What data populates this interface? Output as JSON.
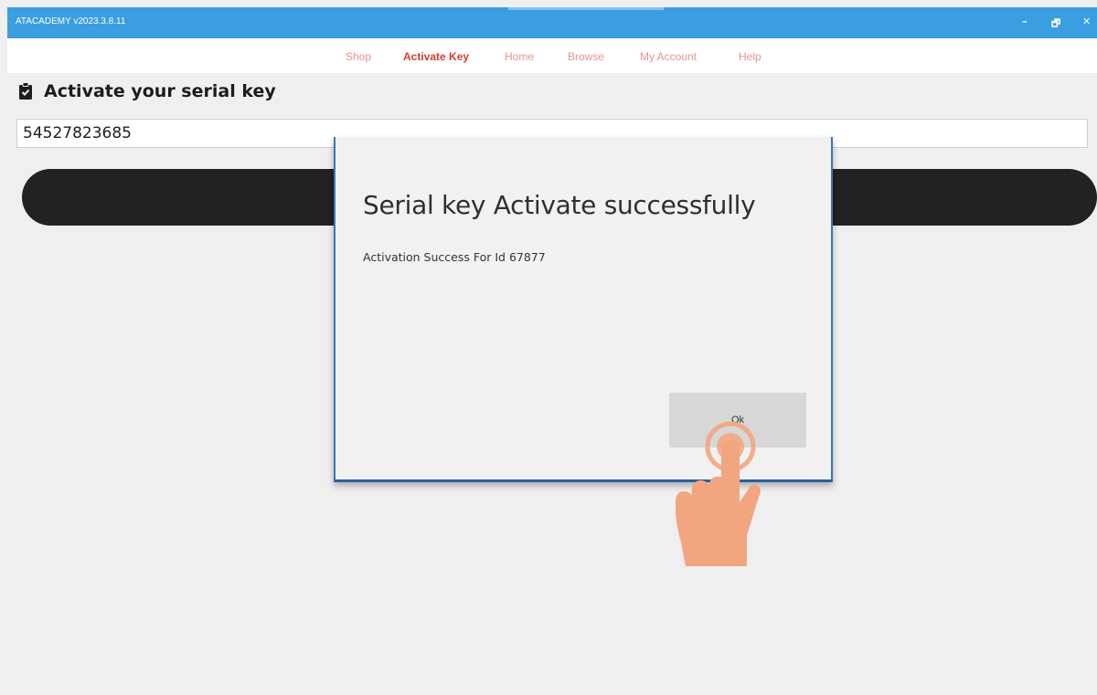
{
  "window": {
    "title": "ATACADEMY v2023.3.8.11",
    "minimize_glyph": "–",
    "restore_glyph": "🗗",
    "close_glyph": "✕"
  },
  "nav": {
    "items": [
      {
        "label": "Shop",
        "active": false
      },
      {
        "label": "Activate Key",
        "active": true
      },
      {
        "label": "Home",
        "active": false
      },
      {
        "label": "Browse",
        "active": false
      },
      {
        "label": "My Account",
        "active": false
      },
      {
        "label": "Help",
        "active": false
      }
    ]
  },
  "page": {
    "heading_icon": "clipboard-check-icon",
    "heading": "Activate your serial key",
    "serial_value": "54527823685"
  },
  "dialog": {
    "title": "Serial key Activate successfully",
    "message": "Activation Success For Id 67877",
    "ok_label": "Ok"
  },
  "overlay": {
    "hand_icon": "tap-hand-icon"
  },
  "colors": {
    "titlebar": "#3a9ee0",
    "nav_link": "#e8928f",
    "nav_active": "#d9392f",
    "activate_button": "#222222",
    "dialog_border": "#3a74b4",
    "hand": "#f2a57e"
  }
}
